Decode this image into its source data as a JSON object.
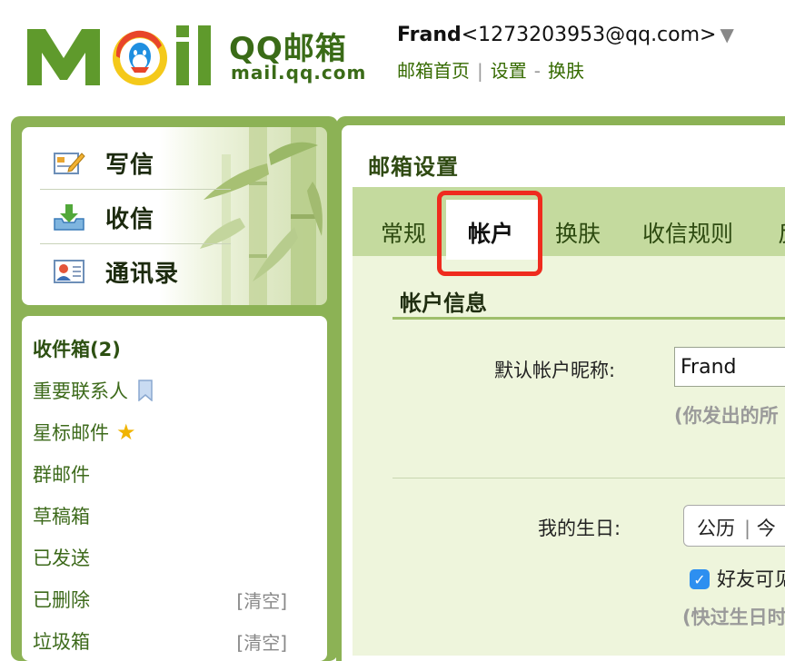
{
  "header": {
    "logo_text": "MOil",
    "logo_name": "QQ邮箱",
    "logo_domain": "mail.qq.com",
    "account_name": "Frand",
    "account_email": "<1273203953@qq.com>",
    "account_caret": "▼",
    "links": {
      "home": "邮箱首页",
      "sep1": "|",
      "settings": "设置",
      "sep2": "-",
      "skin": "换肤"
    }
  },
  "sidebar": {
    "actions": [
      {
        "label": "写信",
        "icon": "compose-icon"
      },
      {
        "label": "收信",
        "icon": "inbox-download-icon"
      },
      {
        "label": "通讯录",
        "icon": "contacts-card-icon"
      }
    ],
    "folders": [
      {
        "label": "收件箱(2)",
        "bold": true
      },
      {
        "label": "重要联系人",
        "icon": "bookmark-flag-icon"
      },
      {
        "label": "星标邮件",
        "icon": "star-icon",
        "icon_glyph": "★"
      },
      {
        "label": "群邮件"
      },
      {
        "label": "草稿箱"
      },
      {
        "label": "已发送"
      },
      {
        "label": "已删除",
        "action": "[清空]"
      },
      {
        "label": "垃圾箱",
        "action": "[清空]"
      }
    ]
  },
  "settings": {
    "title": "邮箱设置",
    "tabs": [
      "常规",
      "帐户",
      "换肤",
      "收信规则",
      "反"
    ],
    "active_tab": "帐户",
    "section_title": "帐户信息",
    "nickname_label": "默认帐户昵称:",
    "nickname_value": "Frand",
    "nickname_hint": "(你发出的所",
    "birthday_label": "我的生日:",
    "calendar_value": "公历",
    "calendar_sep": "|",
    "calendar_next": "今",
    "friend_checkbox_label": "好友可见",
    "birthday_hint": "(快过生日时"
  },
  "colors": {
    "brand_green": "#8cb255",
    "tab_bar": "#c4da9e",
    "highlight_red": "#ef2b1e",
    "checkbox_blue": "#2d8ff0"
  }
}
